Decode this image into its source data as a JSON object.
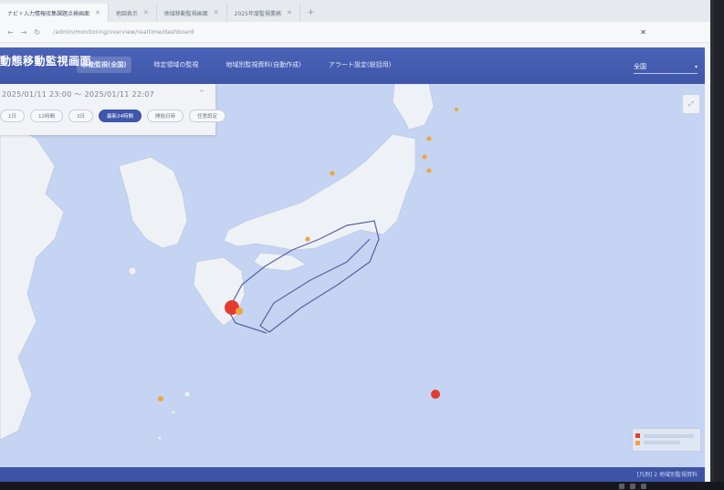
{
  "browser": {
    "tabs": [
      {
        "label": "ナビ＋入力情報収集課題点検画面",
        "active": true
      },
      {
        "label": "地図表示",
        "active": false
      },
      {
        "label": "地域移動監視画面",
        "active": false
      },
      {
        "label": "2025年度監視業務",
        "active": false
      }
    ],
    "url": "/admin/monitoring/overview/realtime/dashboard",
    "tab_close_icon": "close-icon",
    "new_tab_icon": "plus-icon",
    "top_right_icon": "close-icon"
  },
  "app": {
    "title": "動態移動監視画面",
    "nav_tabs": [
      {
        "label": "移動監視(全国)",
        "active": true
      },
      {
        "label": "特定領域の監視",
        "active": false
      },
      {
        "label": "地域別監視資料(自動作成)",
        "active": false
      },
      {
        "label": "アラート設定(総括用)",
        "active": false
      }
    ],
    "region_select": {
      "value": "全国",
      "icon": "chevron-down-icon"
    }
  },
  "time_panel": {
    "range_text": "2025/01/11 23:00 ～ 2025/01/11 22:07",
    "collapse_icon": "chevron-up-icon",
    "chips": [
      {
        "label": "1日",
        "active": false
      },
      {
        "label": "12時間",
        "active": false
      },
      {
        "label": "3日",
        "active": false
      },
      {
        "label": "最新24時間",
        "active": true
      },
      {
        "label": "開始日時",
        "active": false
      },
      {
        "label": "任意設定",
        "active": false
      }
    ]
  },
  "map": {
    "zoom_icon": "expand-icon",
    "colors": {
      "sea": "#c4d4f2",
      "land": "#eef1f6",
      "route": "#5a5fa3",
      "alert_red": "#e53b2f",
      "alert_orange": "#f3a33a"
    }
  },
  "footer": {
    "text": "[凡例] 2 地域別監視資料"
  }
}
